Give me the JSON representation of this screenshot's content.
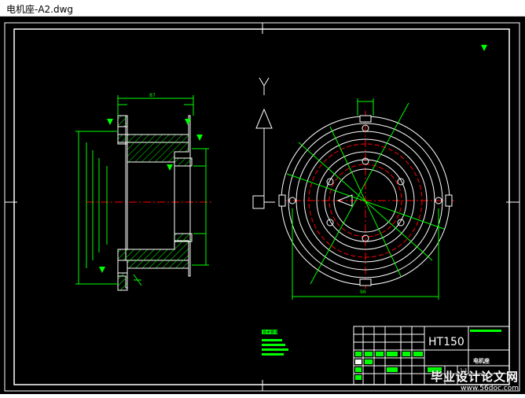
{
  "window": {
    "title": "电机座-A2.dwg"
  },
  "drawing": {
    "material": "HT150",
    "part_name": "电机座",
    "scale": "1:1",
    "tech_req": "技术要求",
    "dims": {
      "top_width": "87",
      "circle_width": "96",
      "dia_small": "φ72",
      "dia_outer": "φ172"
    }
  },
  "watermark": {
    "text": "毕业设计论文网",
    "url": "www.56doc.com"
  },
  "colors": {
    "background": "#000000",
    "outline": "#ffffff",
    "dimension": "#00ff00",
    "center_line": "#ff0000",
    "section": "#00ff00"
  }
}
